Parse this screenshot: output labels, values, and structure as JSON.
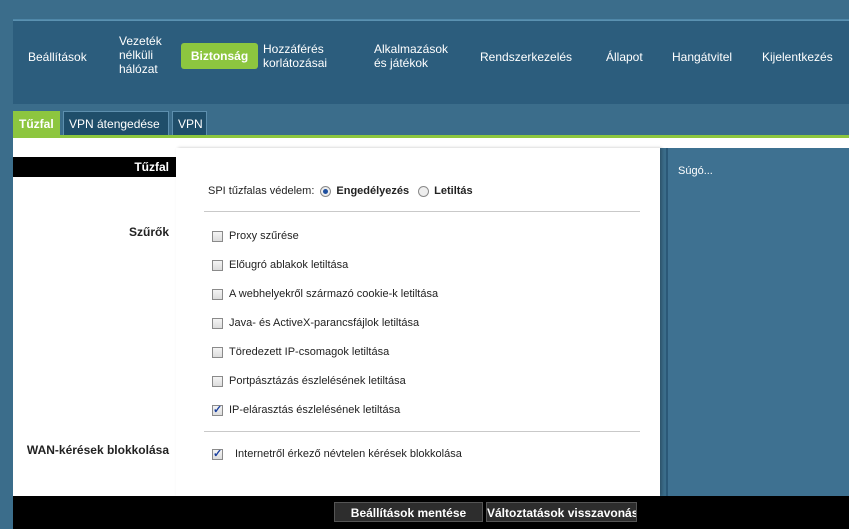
{
  "nav": {
    "items": [
      {
        "label": "Beállítások"
      },
      {
        "label": "Vezeték nélküli hálózat"
      },
      {
        "label": "Biztonság"
      },
      {
        "label": "Hozzáférés korlátozásai"
      },
      {
        "label": "Alkalmazások és játékok"
      },
      {
        "label": "Rendszerkezelés"
      },
      {
        "label": "Állapot"
      },
      {
        "label": "Hangátvitel"
      },
      {
        "label": "Kijelentkezés"
      }
    ],
    "vezetek_lines": [
      "Vezeték",
      "nélküli",
      "hálózat"
    ],
    "hozzaferes_lines": [
      "Hozzáférés",
      "korlátozásai"
    ],
    "alkalmazasok_lines": [
      "Alkalmazások",
      "és játékok"
    ]
  },
  "subtabs": [
    {
      "label": "Tűzfal",
      "active": true
    },
    {
      "label": "VPN átengedése",
      "active": false
    },
    {
      "label": "VPN",
      "active": false
    }
  ],
  "left": {
    "header": "Tűzfal",
    "filters_label": "Szűrők",
    "wan_label": "WAN-kérések blokkolása"
  },
  "spi": {
    "label": "SPI tűzfalas védelem:",
    "enable": "Engedélyezés",
    "disable": "Letiltás",
    "selected": "Engedélyezés"
  },
  "filters": [
    {
      "label": "Proxy szűrése",
      "checked": false
    },
    {
      "label": "Előugró ablakok letiltása",
      "checked": false
    },
    {
      "label": "A webhelyekről származó cookie-k letiltása",
      "checked": false
    },
    {
      "label": "Java- és ActiveX-parancsfájlok letiltása",
      "checked": false
    },
    {
      "label": "Töredezett IP-csomagok letiltása",
      "checked": false
    },
    {
      "label": "Portpásztázás észlelésének letiltása",
      "checked": false
    },
    {
      "label": "IP-elárasztás észlelésének letiltása",
      "checked": true
    }
  ],
  "wan": {
    "label": "Internetről érkező névtelen kérések blokkolása",
    "checked": true
  },
  "help": {
    "label": "Súgó..."
  },
  "footer": {
    "save": "Beállítások mentése",
    "revert": "Változtatások visszavonása"
  },
  "colors": {
    "accent": "#8dc63f",
    "background": "#3b6d8b"
  }
}
